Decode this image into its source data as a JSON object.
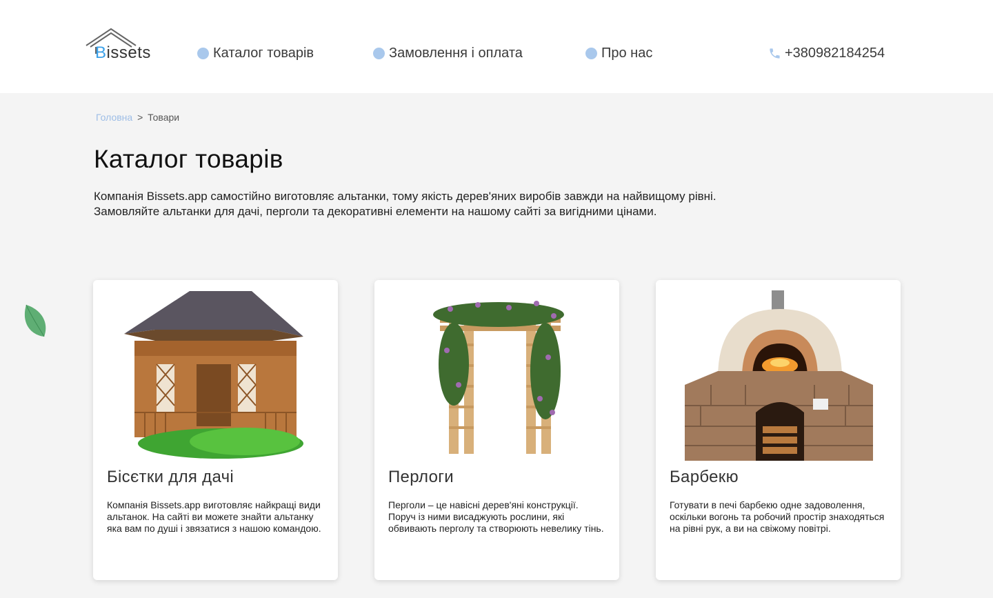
{
  "header": {
    "logo_prefix": "B",
    "logo_rest": "issets",
    "nav": [
      {
        "label": "Каталог товарів"
      },
      {
        "label": "Замовлення і оплата"
      },
      {
        "label": "Про нас"
      }
    ],
    "phone": "+380982184254"
  },
  "breadcrumb": {
    "home": "Головна",
    "separator": ">",
    "current": "Товари"
  },
  "page_title": "Каталог товарів",
  "intro": {
    "line1": "Компанія Bissets.app самостійно виготовляє альтанки, тому якість дерев'яних  виробів завжди на найвищому рівні.",
    "line2": "Замовляйте альтанки для дачі, перголи та декоративні елементи на нашому сайті за вигідними цінами."
  },
  "cards": [
    {
      "title": "Бісєтки для дачі",
      "text": "Компанія Bissets.app виготовляє найкращі види альтанок. На сайті ви можете знайти альтанку яка вам по душі і звязатися з нашою командою.",
      "image": "gazebo-image"
    },
    {
      "title": "Перлоги",
      "text": "Перголи – це навісні дерев'яні конструкції. Поруч із ними висаджують рослини, які обвивають перголу та створюють невелику тінь.",
      "image": "pergola-image"
    },
    {
      "title": "Барбекю",
      "text": "Готувати в печі барбекю одне задоволення, оскільки вогонь та робочий простір знаходяться на рівні рук, а ви на свіжому повітрі.",
      "image": "bbq-oven-image"
    }
  ],
  "colors": {
    "accent": "#a9c8ec",
    "link": "#9dbde6",
    "logo_highlight": "#3aa0e8",
    "page_bg": "#f4f4f4"
  }
}
